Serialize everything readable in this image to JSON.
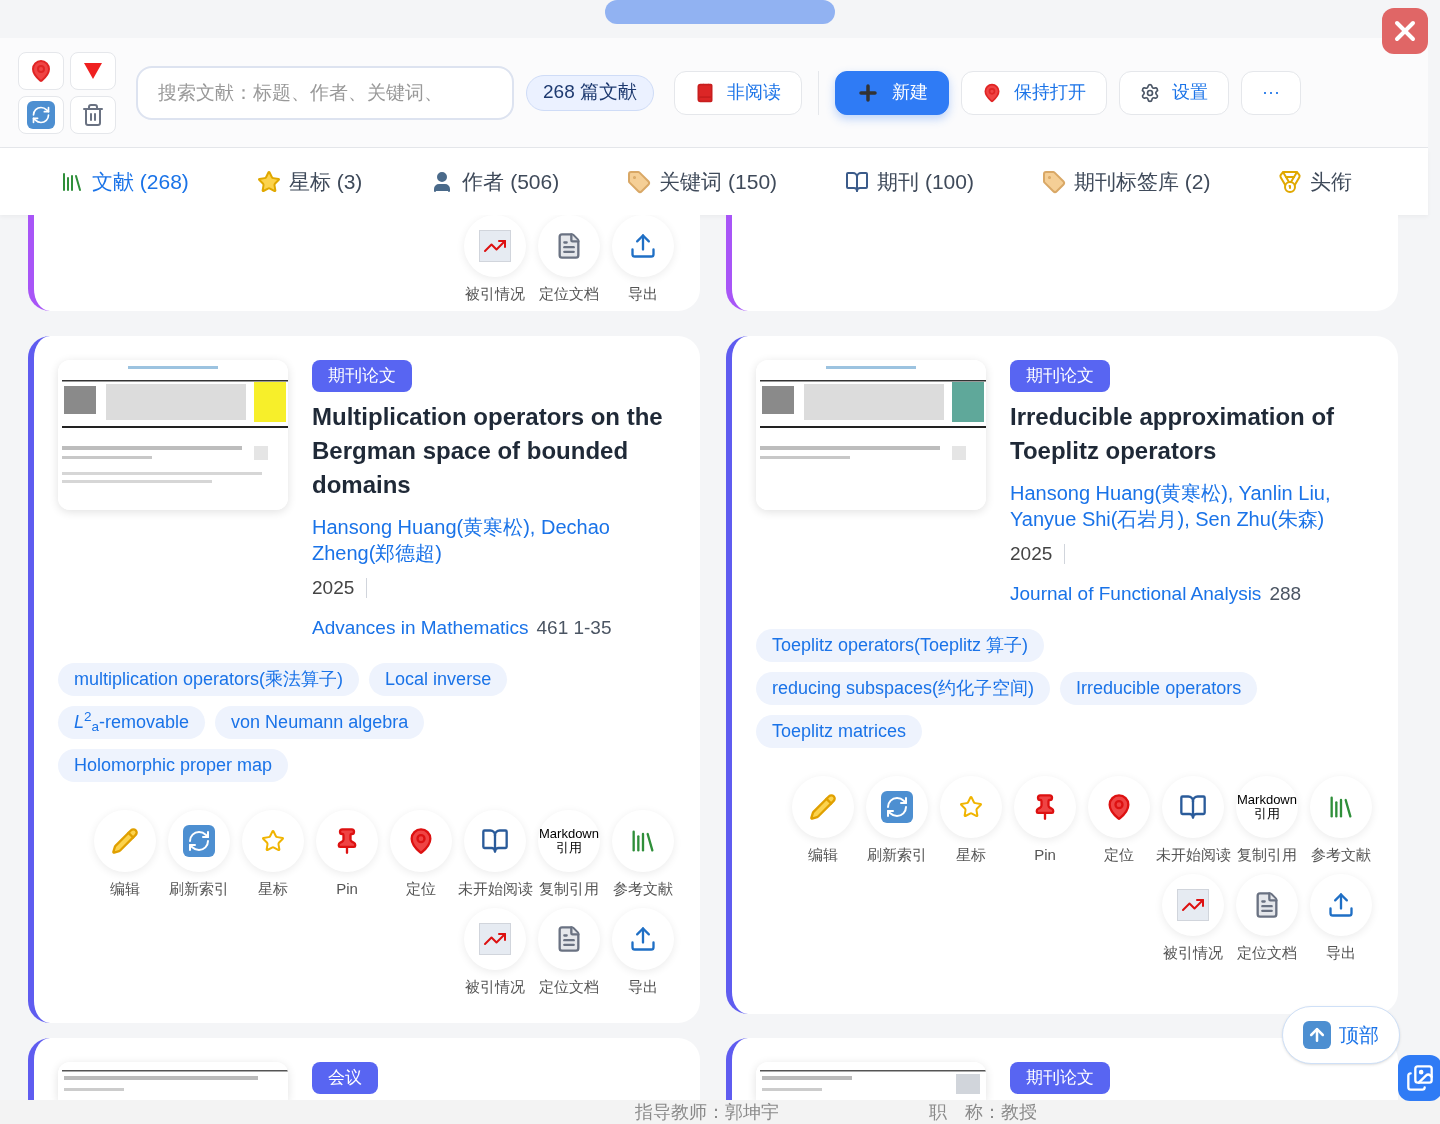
{
  "toolbar": {
    "icon_buttons": [
      {
        "kind": "pin"
      },
      {
        "kind": "filter"
      },
      {
        "kind": "refresh"
      },
      {
        "kind": "trash"
      }
    ],
    "search": {
      "placeholder": "搜索文献：标题、作者、关键词、"
    },
    "count_badge": "268 篇文献",
    "buttons": [
      {
        "kind": "unread",
        "label": "非阅读",
        "primary": false
      },
      {
        "kind": "new",
        "label": "新建",
        "primary": true
      },
      {
        "kind": "keep_open",
        "label": "保持打开",
        "primary": false
      },
      {
        "kind": "settings",
        "label": "设置",
        "primary": false
      },
      {
        "kind": "more",
        "label": "···",
        "primary": false
      }
    ]
  },
  "tabs": [
    {
      "kind": "papers",
      "label": "文献 (268)",
      "selected": true
    },
    {
      "kind": "star",
      "label": "星标 (3)",
      "selected": false
    },
    {
      "kind": "author",
      "label": "作者 (506)",
      "selected": false
    },
    {
      "kind": "tag",
      "label": "关键词 (150)",
      "selected": false
    },
    {
      "kind": "journal",
      "label": "期刊 (100)",
      "selected": false
    },
    {
      "kind": "tag",
      "label": "期刊标签库 (2)",
      "selected": false
    },
    {
      "kind": "medal",
      "label": "头衔",
      "selected": false
    }
  ],
  "top_card_fragment": {
    "actions": [
      {
        "kind": "cited",
        "label": "被引情况"
      },
      {
        "kind": "doc",
        "label": "定位文档"
      },
      {
        "kind": "export",
        "label": "导出"
      }
    ]
  },
  "cards": [
    {
      "badge": "期刊论文",
      "title": "Multiplication operators on the Bergman space of bounded domains",
      "authors": "Hansong Huang(黄寒松), Dechao Zheng(郑德超)",
      "year": "2025",
      "journal": "Advances in Mathematics",
      "volume": "461 1-35",
      "keywords": [
        "multiplication operators(乘法算子)",
        "Local inverse",
        "*L*$^{2}$$_{a}$-removable",
        "von Neumann algebra",
        "Holomorphic proper map"
      ],
      "actions": [
        {
          "kind": "edit",
          "label": "编辑"
        },
        {
          "kind": "refresh",
          "label": "刷新索引"
        },
        {
          "kind": "star",
          "label": "星标"
        },
        {
          "kind": "pin",
          "label": "Pin"
        },
        {
          "kind": "locate",
          "label": "定位"
        },
        {
          "kind": "read",
          "label": "未开始阅读"
        },
        {
          "kind": "cite",
          "label": "复制引用",
          "icon_text": [
            "Markdown",
            "引用"
          ]
        },
        {
          "kind": "refs",
          "label": "参考文献"
        },
        {
          "kind": "cited",
          "label": "被引情况"
        },
        {
          "kind": "doc",
          "label": "定位文档"
        },
        {
          "kind": "export",
          "label": "导出"
        }
      ]
    },
    {
      "badge": "期刊论文",
      "title": "Irreducible approximation of Toeplitz operators",
      "authors": "Hansong Huang(黄寒松), Yanlin Liu, Yanyue Shi(石岩月), Sen Zhu(朱森)",
      "year": "2025",
      "journal": "Journal of Functional Analysis",
      "volume": "288",
      "keywords": [
        "Toeplitz operators(Toeplitz 算子)",
        "reducing subspaces(约化子空间)",
        "Irreducible operators",
        "Toeplitz matrices"
      ],
      "actions": [
        {
          "kind": "edit",
          "label": "编辑"
        },
        {
          "kind": "refresh",
          "label": "刷新索引"
        },
        {
          "kind": "star",
          "label": "星标"
        },
        {
          "kind": "pin",
          "label": "Pin"
        },
        {
          "kind": "locate",
          "label": "定位"
        },
        {
          "kind": "read",
          "label": "未开始阅读"
        },
        {
          "kind": "cite",
          "label": "复制引用",
          "icon_text": [
            "Markdown",
            "引用"
          ]
        },
        {
          "kind": "refs",
          "label": "参考文献"
        },
        {
          "kind": "cited",
          "label": "被引情况"
        },
        {
          "kind": "doc",
          "label": "定位文档"
        },
        {
          "kind": "export",
          "label": "导出"
        }
      ]
    }
  ],
  "bottom_cards": [
    {
      "badge": "会议"
    },
    {
      "badge": "期刊论文"
    }
  ],
  "back_to_top": "顶部",
  "background_text": [
    "指导教师：郭坤宇",
    "职　称：教授"
  ]
}
